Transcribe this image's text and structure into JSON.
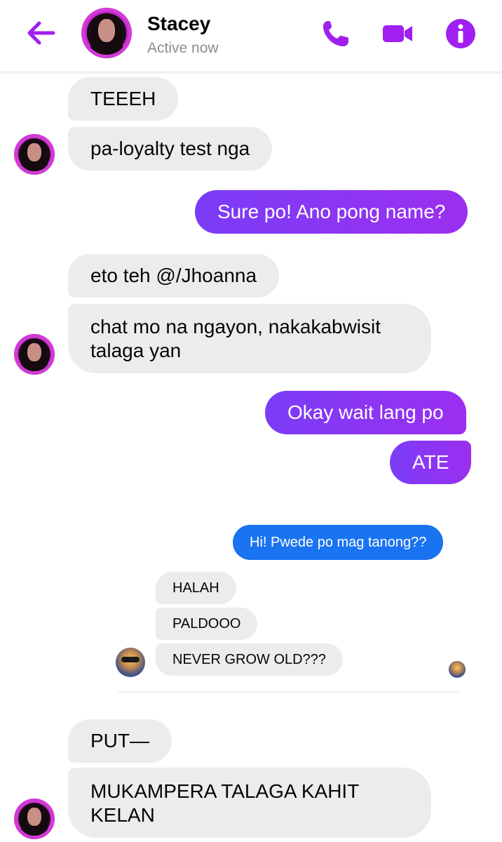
{
  "header": {
    "contact_name": "Stacey",
    "status": "Active now",
    "accent_color": "#a020f0",
    "icons": [
      "back-arrow-icon",
      "phone-icon",
      "video-camera-icon",
      "info-icon"
    ]
  },
  "messages": {
    "m1": "TEEEH",
    "m2": "pa-loyalty test nga",
    "m3": "Sure po! Ano pong name?",
    "m4": "eto teh @/Jhoanna",
    "m5_line1": "chat mo na ngayon, nakakabwisit",
    "m5_line2": "talaga yan",
    "m6": "Okay wait lang po",
    "m7": "ATE",
    "m8": "PUT—",
    "m9_line1": "MUKAMPERA TALAGA KAHIT",
    "m9_line2": "KELAN"
  },
  "embedded_screenshot": {
    "outgoing": "Hi! Pwede po mag tanong??",
    "reply1": "HALAH",
    "reply2": "PALDOOO",
    "reply3": "NEVER GROW OLD???"
  }
}
